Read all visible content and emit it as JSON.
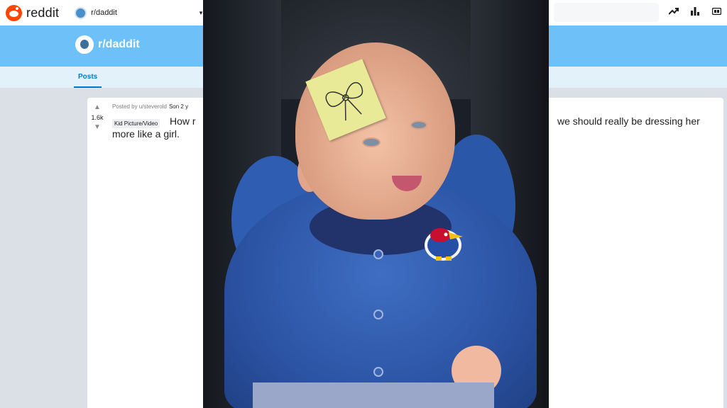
{
  "header": {
    "logo_text": "reddit",
    "community": "r/daddit",
    "caret": "▾"
  },
  "banner": {
    "title": "r/daddit"
  },
  "nav": {
    "tab_posts": "Posts"
  },
  "post": {
    "votes": "1.6k",
    "posted_by": "Posted by u/steverold",
    "posted_extra": "Son 2 y",
    "flair": "Kid Picture/Video",
    "title_start": "How r",
    "title_visible_end": "we should really be dressing her",
    "title_line2": "more like a girl."
  },
  "colors": {
    "reddit_orange": "#ff4500",
    "banner_blue": "#6ec0f9",
    "link_blue": "#0079d3"
  }
}
